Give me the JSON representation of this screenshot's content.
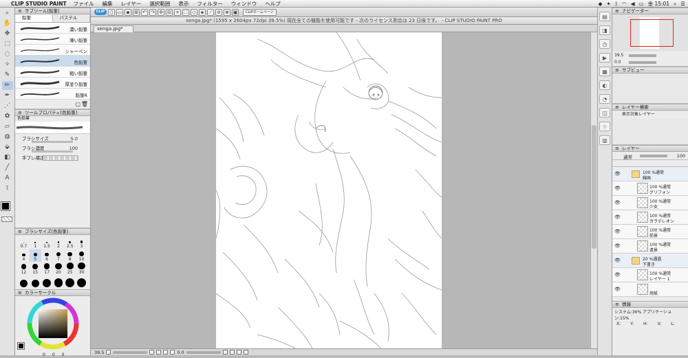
{
  "menubar": {
    "app_name": "CLIP STUDIO PAINT",
    "items": [
      "ファイル",
      "編集",
      "レイヤー",
      "選択範囲",
      "表示",
      "フィルター",
      "ウィンドウ",
      "ヘルプ"
    ],
    "clock": "金 15:01"
  },
  "toolbar": {
    "clip_label": "CLIP",
    "home_label": "CLIPホームページ"
  },
  "title": "senga.jpg* (1595 x 2604px 72dpi 39.5%)  現在全ての機能を使用可能です - 次のライセンス割合は 23 日後です。 - CLIP STUDIO PAINT PRO",
  "document_tab": "senga.jpg*",
  "status": {
    "zoom": "39.5",
    "angle": "0.0"
  },
  "subtool_panel": {
    "header": "サブツール[鉛筆]",
    "tabs": [
      "鉛筆",
      "パステル"
    ],
    "brushes": [
      "濃い鉛筆",
      "薄い鉛筆",
      "シャーペン",
      "色鉛筆",
      "粗い鉛筆",
      "厚塗り鉛筆",
      "鉛筆R"
    ],
    "selected_index": 3
  },
  "tool_property": {
    "header": "ツールプロパティ[色鉛筆]",
    "brush_name": "色鉛筆",
    "size_label": "ブラシサイズ",
    "size_value": "5.0",
    "density_label": "ブラシ濃度",
    "density_value": "100",
    "stabilize_label": "手ブレ補正"
  },
  "brush_size": {
    "header": "ブラシサイズ[色鉛筆]",
    "values": [
      "0.7",
      "1",
      "1.5",
      "2",
      "2.5",
      "3",
      "4",
      "5",
      "6",
      "7",
      "8",
      "10",
      "12",
      "15",
      "17",
      "20",
      "25",
      "30",
      "40",
      "50",
      "60",
      "70",
      "80",
      "100"
    ],
    "selected": "5"
  },
  "color_panel": {
    "header": "カラーサークル",
    "values": [
      "0",
      "0",
      "0"
    ]
  },
  "navigator": {
    "header": "ナビゲーター",
    "zoom": "39.5",
    "angle": "0.0"
  },
  "subview": {
    "header": "サブビュー"
  },
  "layer_search": {
    "header": "レイヤー検索",
    "target": "表示対象レイヤー"
  },
  "layer_panel": {
    "header": "レイヤー",
    "blend_mode": "通常",
    "opacity": "100",
    "layers": [
      {
        "kind": "folder",
        "opacity": "100 %通常",
        "name": "線画"
      },
      {
        "kind": "layer",
        "opacity": "100 %通常",
        "name": "グリフォン"
      },
      {
        "kind": "layer",
        "opacity": "100 %通常",
        "name": "少女"
      },
      {
        "kind": "layer",
        "opacity": "100 %通常",
        "name": "ガラデレオン"
      },
      {
        "kind": "layer",
        "opacity": "100 %通常",
        "name": "前景"
      },
      {
        "kind": "layer",
        "opacity": "100 %通常",
        "name": "遠景"
      },
      {
        "kind": "folder",
        "opacity": "20 %通過",
        "name": "下書き"
      },
      {
        "kind": "layer",
        "opacity": "100 %通常",
        "name": "レイヤー 1"
      },
      {
        "kind": "layer",
        "opacity": "",
        "name": "用紙"
      }
    ]
  },
  "info_panel": {
    "header": "情報",
    "system_line": "システム:36% アプリケーション:15%",
    "labels": [
      "X:",
      "Y:",
      "H:",
      "V:",
      "L:"
    ]
  },
  "colors": {
    "accent": "#3b8ed6",
    "selection": "#c8dcee",
    "nav_frame": "#e02020"
  }
}
